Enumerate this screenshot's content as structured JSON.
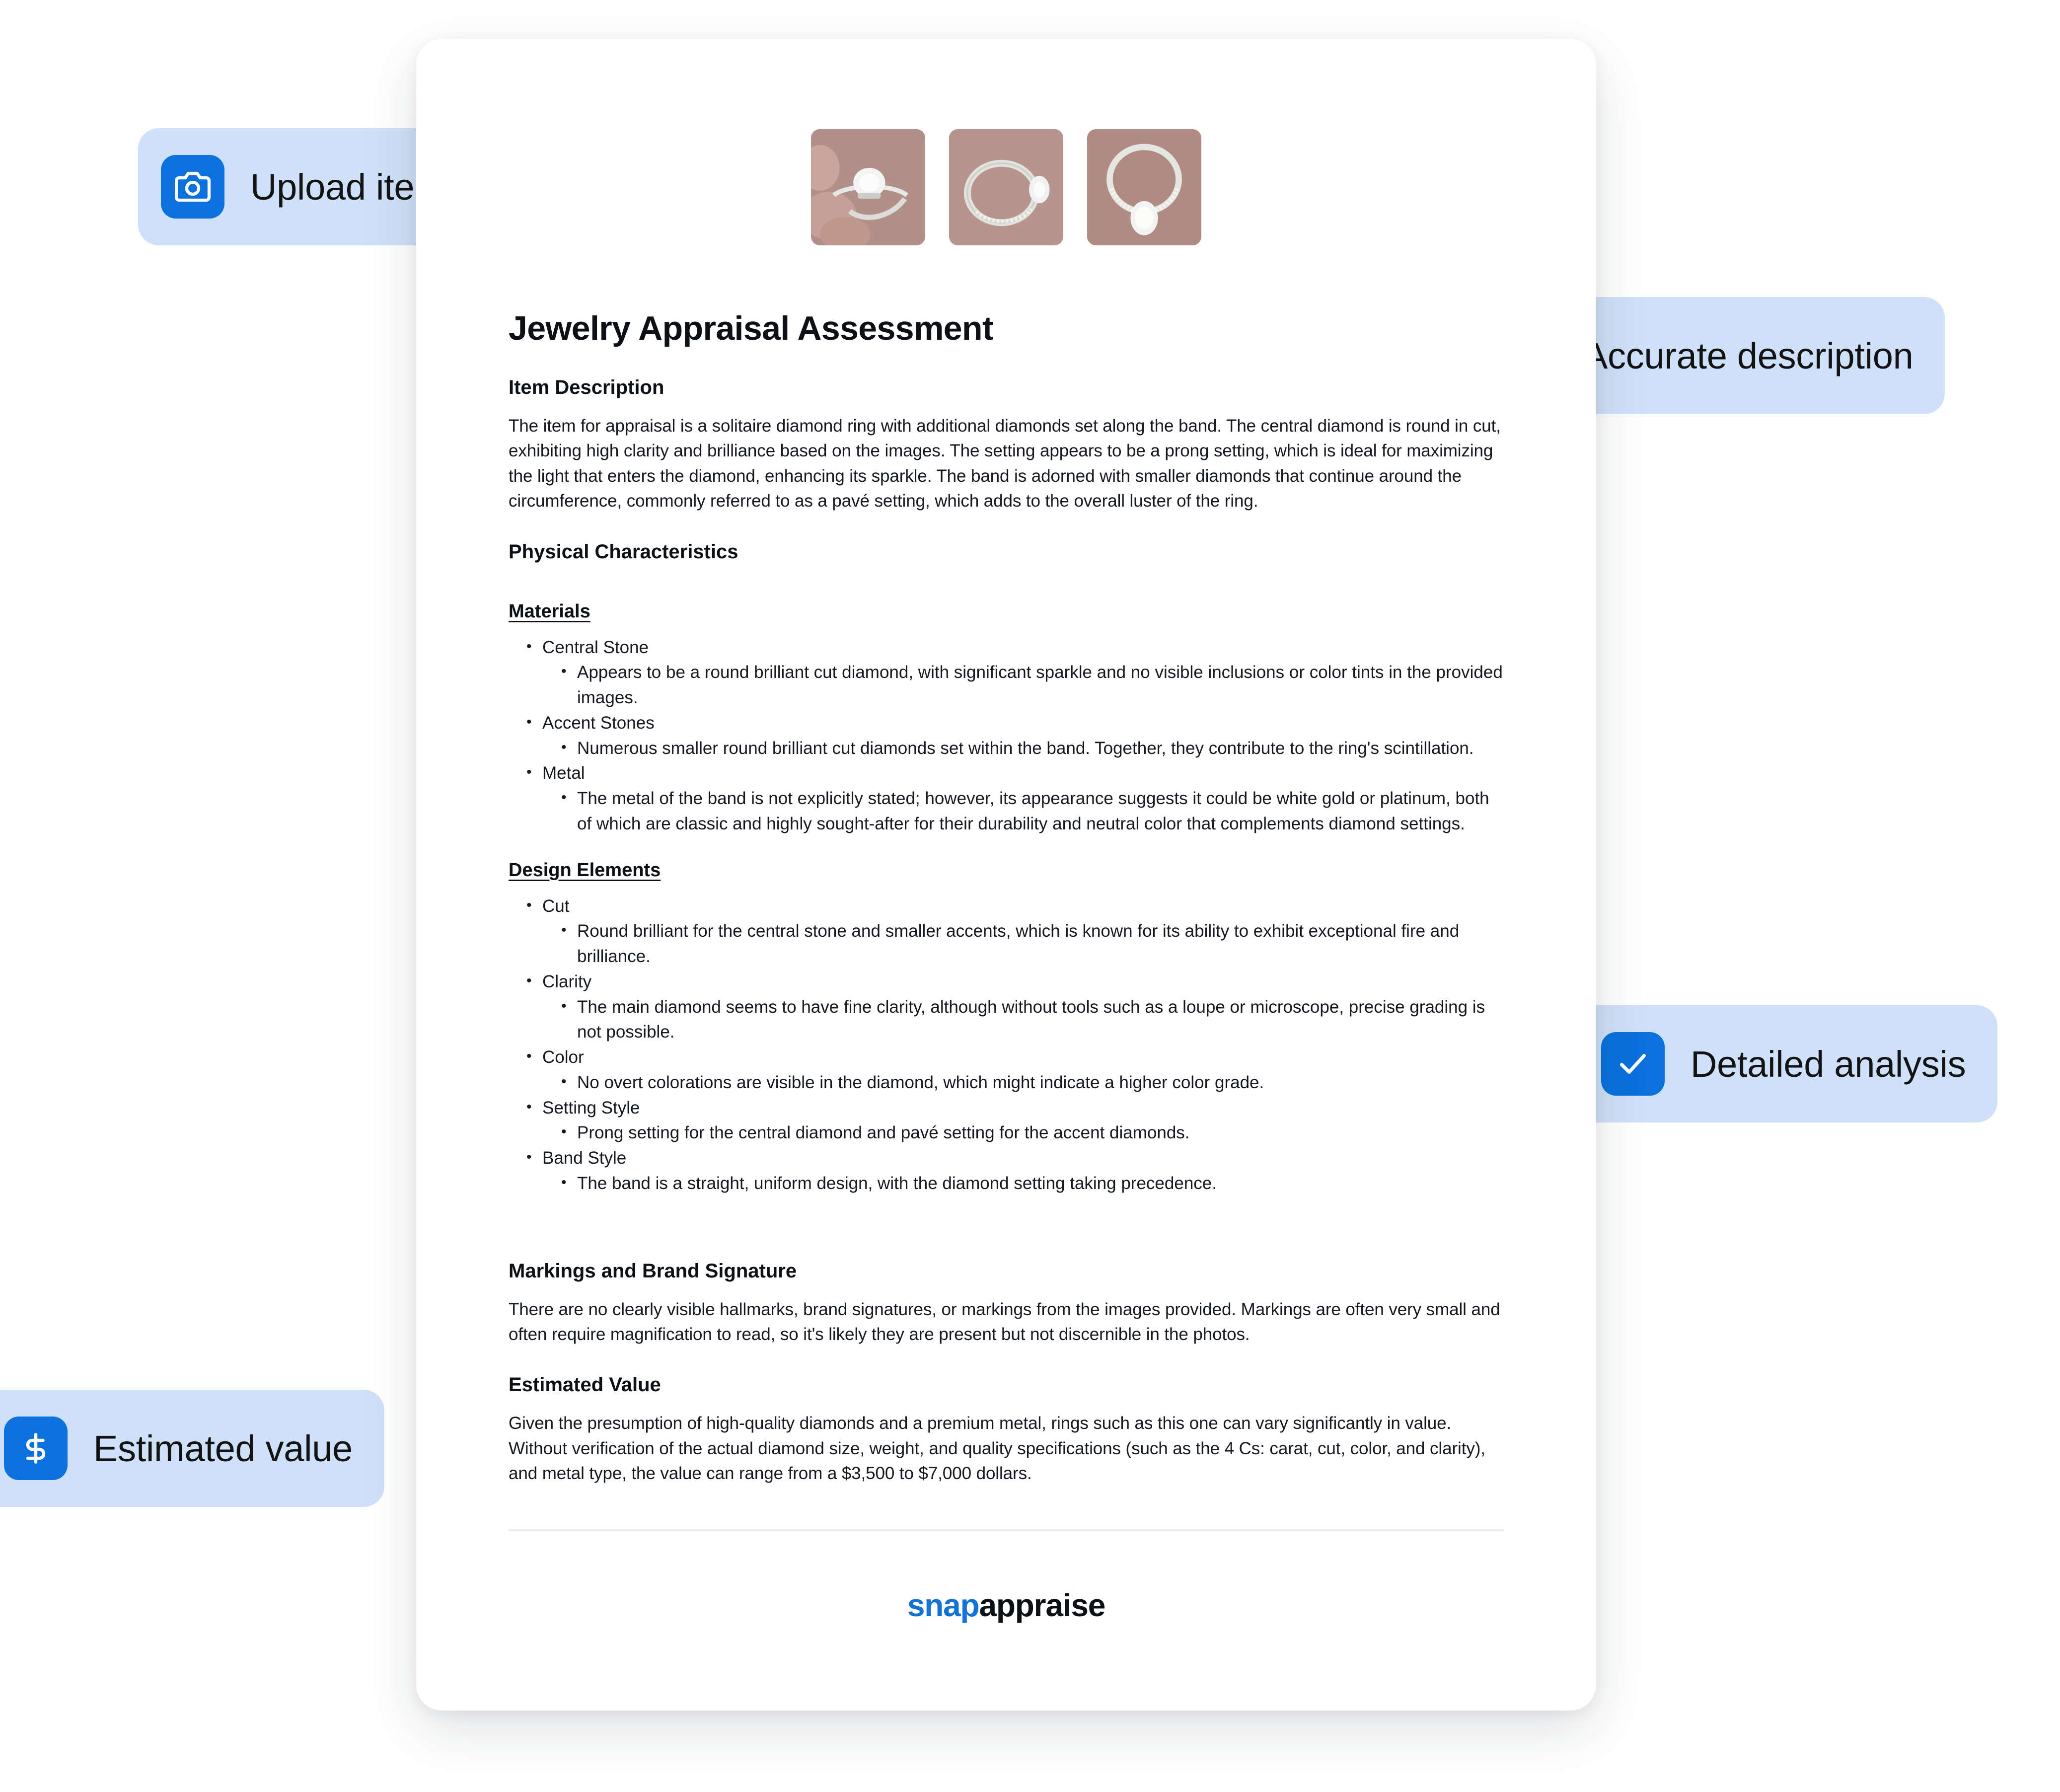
{
  "theme": {
    "accent_blue": "#0a71dd",
    "pill_bg": "#cfe1f8",
    "card_bg": "#ffffff",
    "page_bg": "#ffffff",
    "divider": "#eceef0",
    "brand_blue": "#1272d6"
  },
  "pills": [
    {
      "id": "upload",
      "label": "Upload item photos",
      "icon": "camera-icon"
    },
    {
      "id": "accurate",
      "label": "Accurate description",
      "icon": "search-icon"
    },
    {
      "id": "detailed",
      "label": "Detailed analysis",
      "icon": "check-icon"
    },
    {
      "id": "value",
      "label": "Estimated value",
      "icon": "dollar-icon"
    }
  ],
  "thumbnails": [
    {
      "alt": "diamond-ring-held-in-fingers"
    },
    {
      "alt": "diamond-ring-side-profile"
    },
    {
      "alt": "diamond-ring-top-down-band"
    }
  ],
  "document": {
    "title": "Jewelry Appraisal Assessment",
    "item_description": {
      "heading": "Item Description",
      "text": "The item for appraisal is a solitaire diamond ring with additional diamonds set along the band. The central diamond is round in cut, exhibiting high clarity and brilliance based on the images. The setting appears to be a prong setting, which is ideal for maximizing the light that enters the diamond, enhancing its sparkle. The band is adorned with smaller diamonds that continue around the circumference, commonly referred to as a pavé setting, which adds to the overall luster of the ring."
    },
    "physical_characteristics": {
      "heading": "Physical Characteristics",
      "materials": {
        "heading": "Materials",
        "items": [
          {
            "label": "Central Stone",
            "detail": "Appears to be a round brilliant cut diamond, with significant sparkle and no visible inclusions or color tints in the provided images."
          },
          {
            "label": "Accent Stones",
            "detail": "Numerous smaller round brilliant cut diamonds set within the band. Together, they contribute to the ring's scintillation."
          },
          {
            "label": "Metal",
            "detail": "The metal of the band is not explicitly stated; however, its appearance suggests it could be white gold or platinum, both of which are classic and highly sought-after for their durability and neutral color that complements diamond settings."
          }
        ]
      },
      "design_elements": {
        "heading": "Design Elements",
        "items": [
          {
            "label": "Cut",
            "detail": "Round brilliant for the central stone and smaller accents, which is known for its ability to exhibit exceptional fire and brilliance."
          },
          {
            "label": "Clarity",
            "detail": "The main diamond seems to have fine clarity, although without tools such as a loupe or microscope, precise grading is not possible."
          },
          {
            "label": "Color",
            "detail": "No overt colorations are visible in the diamond, which might indicate a higher color grade."
          },
          {
            "label": "Setting Style",
            "detail": "Prong setting for the central diamond and pavé setting for the accent diamonds."
          },
          {
            "label": "Band Style",
            "detail": "The band is a straight, uniform design, with the diamond setting taking precedence."
          }
        ]
      }
    },
    "markings": {
      "heading": "Markings and Brand Signature",
      "text": "There are no clearly visible hallmarks, brand signatures, or markings from the images provided. Markings are often very small and often require magnification to read, so it's likely they are present but not discernible in the photos."
    },
    "estimated_value": {
      "heading": "Estimated Value",
      "text": "Given the presumption of high-quality diamonds and a premium metal, rings such as this one can vary significantly in value. Without verification of the actual diamond size, weight, and quality specifications (such as the 4 Cs: carat, cut, color, and clarity), and metal type, the value can range from a $3,500 to $7,000 dollars."
    },
    "brand": {
      "part1": "snap",
      "part2": "appraise"
    }
  }
}
